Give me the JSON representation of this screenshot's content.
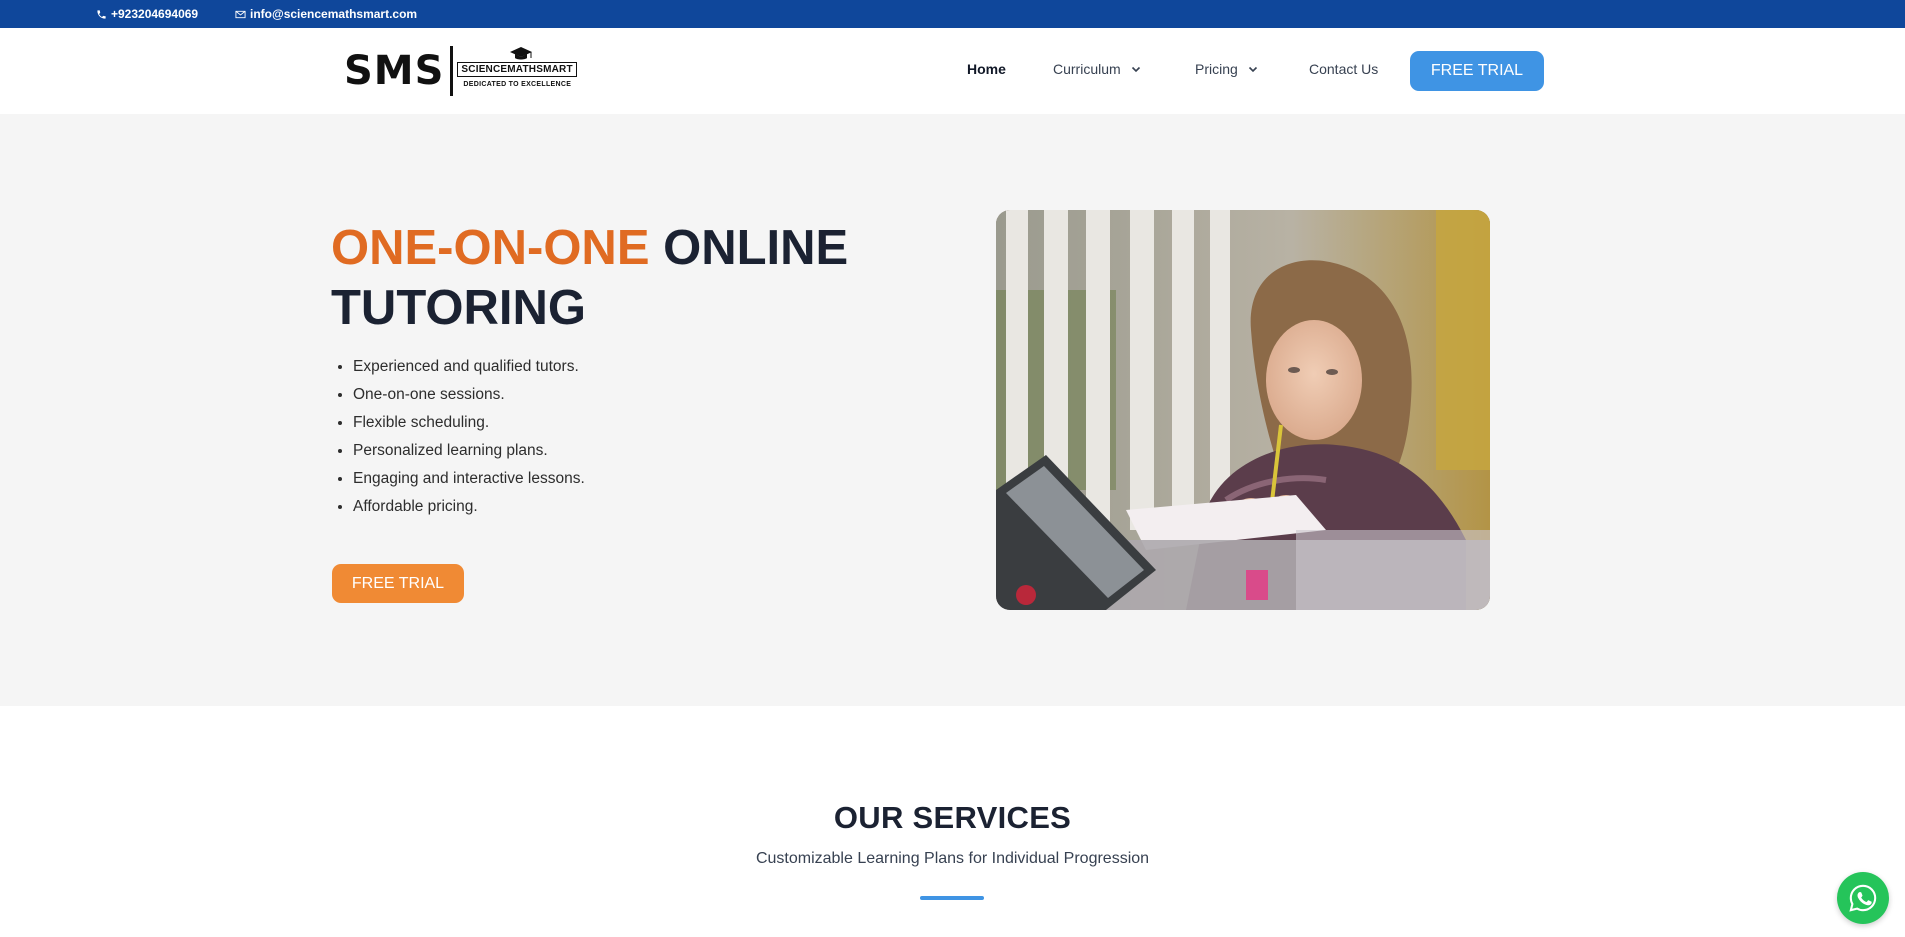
{
  "topbar": {
    "phone": "+923204694069",
    "email": "info@sciencemathsmart.com",
    "bg_color": "#0f479b"
  },
  "header": {
    "logo": {
      "mark": "SMS",
      "name": "SCIENCEMATHSMART",
      "tagline": "DEDICATED TO EXCELLENCE"
    },
    "nav": {
      "home": "Home",
      "curriculum": "Curriculum",
      "pricing": "Pricing",
      "contact": "Contact Us"
    },
    "cta_label": "FREE TRIAL",
    "cta_color": "#3f94e4"
  },
  "hero": {
    "title_highlight": "ONE-ON-ONE",
    "title_rest": "ONLINE TUTORING",
    "highlight_color": "#e06b22",
    "features": [
      "Experienced and qualified tutors.",
      "One-on-one sessions.",
      "Flexible scheduling.",
      "Personalized learning plans.",
      "Engaging and interactive lessons.",
      "Affordable pricing."
    ],
    "cta_label": "FREE TRIAL",
    "cta_color": "#f08a34",
    "image_icon": "child-studying-photo"
  },
  "services": {
    "title": "OUR SERVICES",
    "subtitle": "Customizable Learning Plans for Individual Progression"
  },
  "floating": {
    "icon": "whatsapp-icon",
    "color": "#25c45a"
  }
}
